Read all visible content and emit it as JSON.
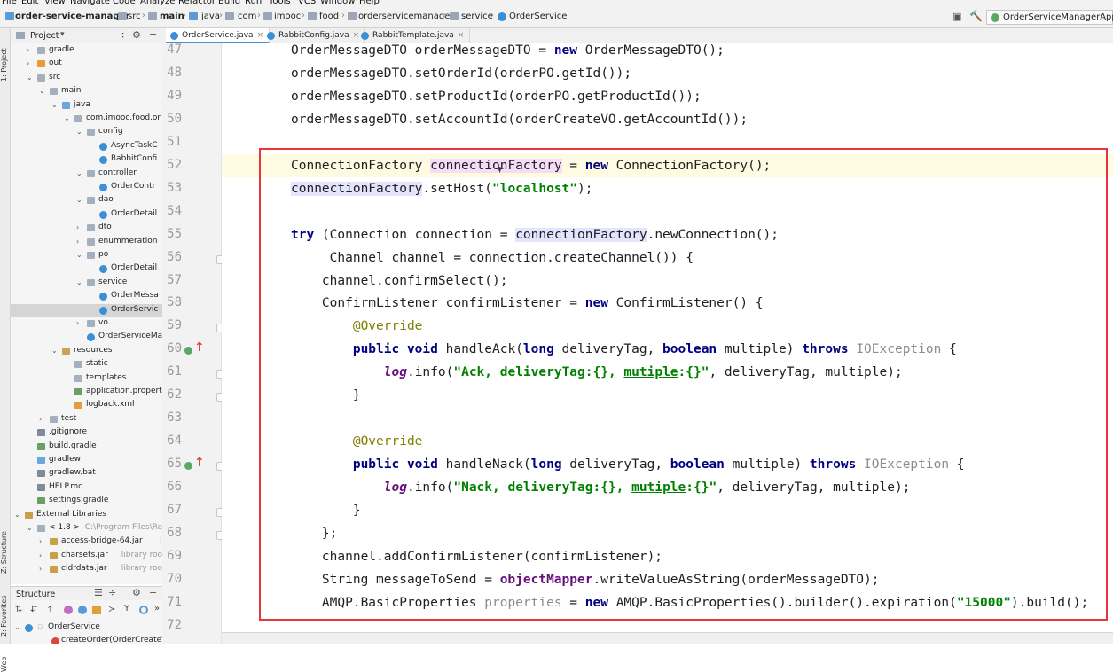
{
  "menu": [
    "File",
    "Edit",
    "View",
    "Navigate",
    "Code",
    "Analyze",
    "Refactor",
    "Build",
    "Run",
    "Tools",
    "VCS",
    "Window",
    "Help"
  ],
  "breadcrumbs": [
    "order-service-manager",
    "src",
    "main",
    "java",
    "com",
    "imooc",
    "food",
    "orderservicemanager",
    "service",
    "OrderService"
  ],
  "run_config": "OrderServiceManagerApplica",
  "left_strip": {
    "project": "1: Project",
    "structure": "Z: Structure",
    "favorites": "2: Favorites",
    "web": "Web"
  },
  "project_panel": {
    "title": "Project"
  },
  "tree": [
    {
      "label": "gradle",
      "depth": 1,
      "arrow": "›",
      "icon": "fold"
    },
    {
      "label": "out",
      "depth": 1,
      "arrow": "›",
      "icon": "excl"
    },
    {
      "label": "src",
      "depth": 1,
      "arrow": "⌄",
      "icon": "fold"
    },
    {
      "label": "main",
      "depth": 2,
      "arrow": "⌄",
      "icon": "fold"
    },
    {
      "label": "java",
      "depth": 3,
      "arrow": "⌄",
      "icon": "src"
    },
    {
      "label": "com.imooc.food.or",
      "depth": 4,
      "arrow": "⌄",
      "icon": "fold"
    },
    {
      "label": "config",
      "depth": 5,
      "arrow": "⌄",
      "icon": "fold"
    },
    {
      "label": "AsyncTaskC",
      "depth": 6,
      "arrow": "",
      "icon": "cls"
    },
    {
      "label": "RabbitConfi",
      "depth": 6,
      "arrow": "",
      "icon": "cls"
    },
    {
      "label": "controller",
      "depth": 5,
      "arrow": "⌄",
      "icon": "fold"
    },
    {
      "label": "OrderContr",
      "depth": 6,
      "arrow": "",
      "icon": "cls"
    },
    {
      "label": "dao",
      "depth": 5,
      "arrow": "⌄",
      "icon": "fold"
    },
    {
      "label": "OrderDetail",
      "depth": 6,
      "arrow": "",
      "icon": "cls"
    },
    {
      "label": "dto",
      "depth": 5,
      "arrow": "›",
      "icon": "fold"
    },
    {
      "label": "enummeration",
      "depth": 5,
      "arrow": "›",
      "icon": "fold"
    },
    {
      "label": "po",
      "depth": 5,
      "arrow": "⌄",
      "icon": "fold"
    },
    {
      "label": "OrderDetail",
      "depth": 6,
      "arrow": "",
      "icon": "cls"
    },
    {
      "label": "service",
      "depth": 5,
      "arrow": "⌄",
      "icon": "fold"
    },
    {
      "label": "OrderMessa",
      "depth": 6,
      "arrow": "",
      "icon": "cls"
    },
    {
      "label": "OrderServic",
      "depth": 6,
      "arrow": "",
      "icon": "cls",
      "selected": true
    },
    {
      "label": "vo",
      "depth": 5,
      "arrow": "›",
      "icon": "fold"
    },
    {
      "label": "OrderServiceMa",
      "depth": 5,
      "arrow": "",
      "icon": "cls"
    },
    {
      "label": "resources",
      "depth": 3,
      "arrow": "⌄",
      "icon": "res"
    },
    {
      "label": "static",
      "depth": 4,
      "arrow": "",
      "icon": "fold"
    },
    {
      "label": "templates",
      "depth": 4,
      "arrow": "",
      "icon": "fold"
    },
    {
      "label": "application.propert",
      "depth": 4,
      "arrow": "",
      "icon": "gr"
    },
    {
      "label": "logback.xml",
      "depth": 4,
      "arrow": "",
      "icon": "excl"
    },
    {
      "label": "test",
      "depth": 2,
      "arrow": "›",
      "icon": "fold"
    },
    {
      "label": ".gitignore",
      "depth": 1,
      "arrow": "",
      "icon": "file"
    },
    {
      "label": "build.gradle",
      "depth": 1,
      "arrow": "",
      "icon": "gr"
    },
    {
      "label": "gradlew",
      "depth": 1,
      "arrow": "",
      "icon": "src"
    },
    {
      "label": "gradlew.bat",
      "depth": 1,
      "arrow": "",
      "icon": "file"
    },
    {
      "label": "HELP.md",
      "depth": 1,
      "arrow": "",
      "icon": "file"
    },
    {
      "label": "settings.gradle",
      "depth": 1,
      "arrow": "",
      "icon": "gr"
    },
    {
      "label": "External Libraries",
      "depth": 0,
      "arrow": "⌄",
      "icon": "jar"
    },
    {
      "label": "< 1.8 >",
      "depth": 1,
      "arrow": "⌄",
      "icon": "fold",
      "muted": "C:\\Program Files\\Red"
    },
    {
      "label": "access-bridge-64.jar",
      "depth": 2,
      "arrow": "›",
      "icon": "jar",
      "muted": "libra"
    },
    {
      "label": "charsets.jar",
      "depth": 2,
      "arrow": "›",
      "icon": "jar",
      "muted": "library root"
    },
    {
      "label": "cldrdata.jar",
      "depth": 2,
      "arrow": "›",
      "icon": "jar",
      "muted": "library root"
    }
  ],
  "structure_panel": {
    "title": "Structure",
    "root": "OrderService",
    "child": "createOrder(OrderCreateV"
  },
  "tabs": [
    {
      "label": "OrderService.java",
      "active": true
    },
    {
      "label": "RabbitConfig.java",
      "active": false
    },
    {
      "label": "RabbitTemplate.java",
      "active": false
    }
  ],
  "line_numbers": [
    "47",
    "48",
    "49",
    "50",
    "51",
    "52",
    "53",
    "54",
    "55",
    "56",
    "57",
    "58",
    "59",
    "60",
    "61",
    "62",
    "63",
    "64",
    "65",
    "66",
    "67",
    "68",
    "69",
    "70",
    "71",
    "72"
  ],
  "code_lines": [
    [
      {
        "t": "OrderMessageDTO orderMessageDTO = "
      },
      {
        "t": "new",
        "c": "kw"
      },
      {
        "t": " OrderMessageDTO();"
      }
    ],
    [
      {
        "t": "orderMessageDTO.setOrderId(orderPO.getId());"
      }
    ],
    [
      {
        "t": "orderMessageDTO.setProductId(orderPO.getProductId());"
      }
    ],
    [
      {
        "t": "orderMessageDTO.setAccountId(orderCreateVO.getAccountId());"
      }
    ],
    [],
    [
      {
        "t": "ConnectionFactory "
      },
      {
        "t": "connectionFactory",
        "c": "hlr"
      },
      {
        "t": " = "
      },
      {
        "t": "new",
        "c": "kw"
      },
      {
        "t": " ConnectionFactory();"
      }
    ],
    [
      {
        "t": "connectionFactory",
        "c": "hlw"
      },
      {
        "t": ".setHost("
      },
      {
        "t": "\"localhost\"",
        "c": "str"
      },
      {
        "t": ");"
      }
    ],
    [],
    [
      {
        "t": "try",
        "c": "kw"
      },
      {
        "t": " (Connection connection = "
      },
      {
        "t": "connectionFactory",
        "c": "hlw"
      },
      {
        "t": ".newConnection();"
      }
    ],
    [
      {
        "t": "     Channel channel = connection.createChannel()) {"
      }
    ],
    [
      {
        "t": "    channel.confirmSelect();"
      }
    ],
    [
      {
        "t": "    ConfirmListener confirmListener = "
      },
      {
        "t": "new",
        "c": "kw"
      },
      {
        "t": " ConfirmListener() {"
      }
    ],
    [
      {
        "t": "        "
      },
      {
        "t": "@Override",
        "c": "ann"
      }
    ],
    [
      {
        "t": "        "
      },
      {
        "t": "public void",
        "c": "kw"
      },
      {
        "t": " handleAck("
      },
      {
        "t": "long",
        "c": "kw"
      },
      {
        "t": " deliveryTag, "
      },
      {
        "t": "boolean",
        "c": "kw"
      },
      {
        "t": " multiple) "
      },
      {
        "t": "throws",
        "c": "kw"
      },
      {
        "t": " "
      },
      {
        "t": "IOException",
        "c": "gray"
      },
      {
        "t": " {"
      }
    ],
    [
      {
        "t": "            "
      },
      {
        "t": "log",
        "c": "logv"
      },
      {
        "t": ".info("
      },
      {
        "t": "\"Ack, deliveryTag:{}, mutiple:{}\"",
        "c": "str"
      },
      {
        "t": ", deliveryTag, multiple);"
      }
    ],
    [
      {
        "t": "        }"
      }
    ],
    [],
    [
      {
        "t": "        "
      },
      {
        "t": "@Override",
        "c": "ann"
      }
    ],
    [
      {
        "t": "        "
      },
      {
        "t": "public void",
        "c": "kw"
      },
      {
        "t": " handleNack("
      },
      {
        "t": "long",
        "c": "kw"
      },
      {
        "t": " deliveryTag, "
      },
      {
        "t": "boolean",
        "c": "kw"
      },
      {
        "t": " multiple) "
      },
      {
        "t": "throws",
        "c": "kw"
      },
      {
        "t": " "
      },
      {
        "t": "IOException",
        "c": "gray"
      },
      {
        "t": " {"
      }
    ],
    [
      {
        "t": "            "
      },
      {
        "t": "log",
        "c": "logv"
      },
      {
        "t": ".info("
      },
      {
        "t": "\"Nack, deliveryTag:{}, mutiple:{}\"",
        "c": "str"
      },
      {
        "t": ", deliveryTag, multiple);"
      }
    ],
    [
      {
        "t": "        }"
      }
    ],
    [
      {
        "t": "    };"
      }
    ],
    [
      {
        "t": "    channel.addConfirmListener(confirmListener);"
      }
    ],
    [
      {
        "t": "    String messageToSend = "
      },
      {
        "t": "objectMapper",
        "c": "fld"
      },
      {
        "t": ".writeValueAsString(orderMessageDTO);"
      }
    ],
    [
      {
        "t": "    AMQP.BasicProperties "
      },
      {
        "t": "properties",
        "c": "gray"
      },
      {
        "t": " = "
      },
      {
        "t": "new",
        "c": "kw"
      },
      {
        "t": " AMQP.BasicProperties().builder().expiration("
      },
      {
        "t": "\"15000\"",
        "c": "str"
      },
      {
        "t": ").build();"
      }
    ],
    []
  ]
}
